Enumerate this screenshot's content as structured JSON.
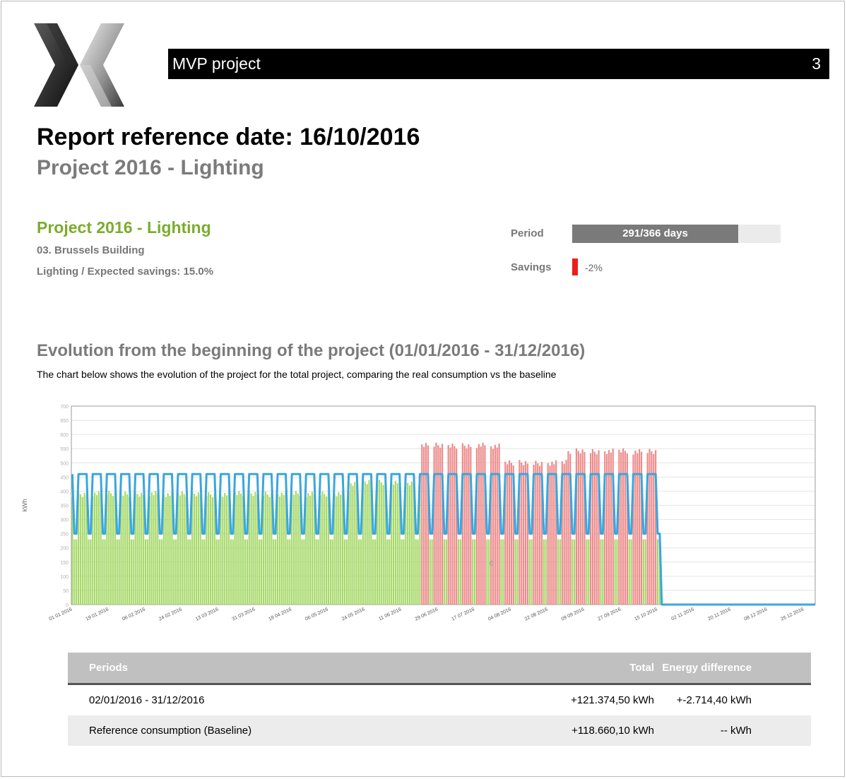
{
  "header": {
    "project_name": "MVP project",
    "page_number": "3"
  },
  "report": {
    "title": "Report reference date: 16/10/2016",
    "subtitle": "Project 2016 - Lighting"
  },
  "project": {
    "name": "Project 2016 - Lighting",
    "building": "03. Brussels Building",
    "details": "Lighting / Expected savings: 15.0%"
  },
  "kpi": {
    "period_label": "Period",
    "period_text": "291/366 days",
    "period_fraction": 0.795,
    "savings_label": "Savings",
    "savings_value": "-2%"
  },
  "section": {
    "title": "Evolution from the beginning of the project (01/01/2016 - 31/12/2016)",
    "description": "The chart below shows the evolution of the project for the total project, comparing the real consumption vs the baseline"
  },
  "chart_data": {
    "type": "bar",
    "ylabel": "kWh",
    "ylim": [
      0,
      700
    ],
    "yticks": [
      0,
      50,
      100,
      150,
      200,
      250,
      300,
      350,
      400,
      450,
      500,
      550,
      600,
      650,
      700
    ],
    "grid": true,
    "center_mark": "0",
    "x_tick_labels": [
      "01 01 2016",
      "19 01 2016",
      "06 02 2016",
      "24 02 2016",
      "13 03 2016",
      "31 03 2016",
      "18 04 2016",
      "06 05 2016",
      "24 05 2016",
      "11 06 2016",
      "29 06 2016",
      "17 07 2016",
      "04 08 2016",
      "22 08 2016",
      "09 09 2016",
      "27 09 2016",
      "15 10 2016",
      "02 11 2016",
      "20 11 2016",
      "08 12 2016",
      "26 12 2016"
    ],
    "start_date": "01/01/2016",
    "total_days": 366,
    "data_days": 290,
    "series": [
      {
        "role": "consumption-below-baseline",
        "color": "#a7d96b"
      },
      {
        "role": "consumption-above-baseline",
        "color": "#ec8c8c"
      },
      {
        "role": "baseline",
        "color": "#3aa6dd"
      }
    ],
    "baseline_pattern": {
      "weekday_kwh": 460,
      "weekend_kwh": 250
    },
    "consumption_pattern": {
      "weekday_kwh_by_period": [
        {
          "until": "16/05/2016",
          "kwh": 390
        },
        {
          "until": "20/06/2016",
          "kwh": 430
        },
        {
          "until": "31/07/2016",
          "kwh": 560
        },
        {
          "until": "31/08/2016",
          "kwh": 500
        },
        {
          "until": "16/10/2016",
          "kwh": 540
        }
      ],
      "weekend_kwh": 230
    }
  },
  "table": {
    "headers": [
      "Periods",
      "Total",
      "Energy difference"
    ],
    "rows": [
      [
        "02/01/2016 - 31/12/2016",
        "+121.374,50 kWh",
        "+-2.714,40 kWh"
      ],
      [
        "Reference consumption (Baseline)",
        "+118.660,10 kWh",
        "-- kWh"
      ]
    ]
  }
}
